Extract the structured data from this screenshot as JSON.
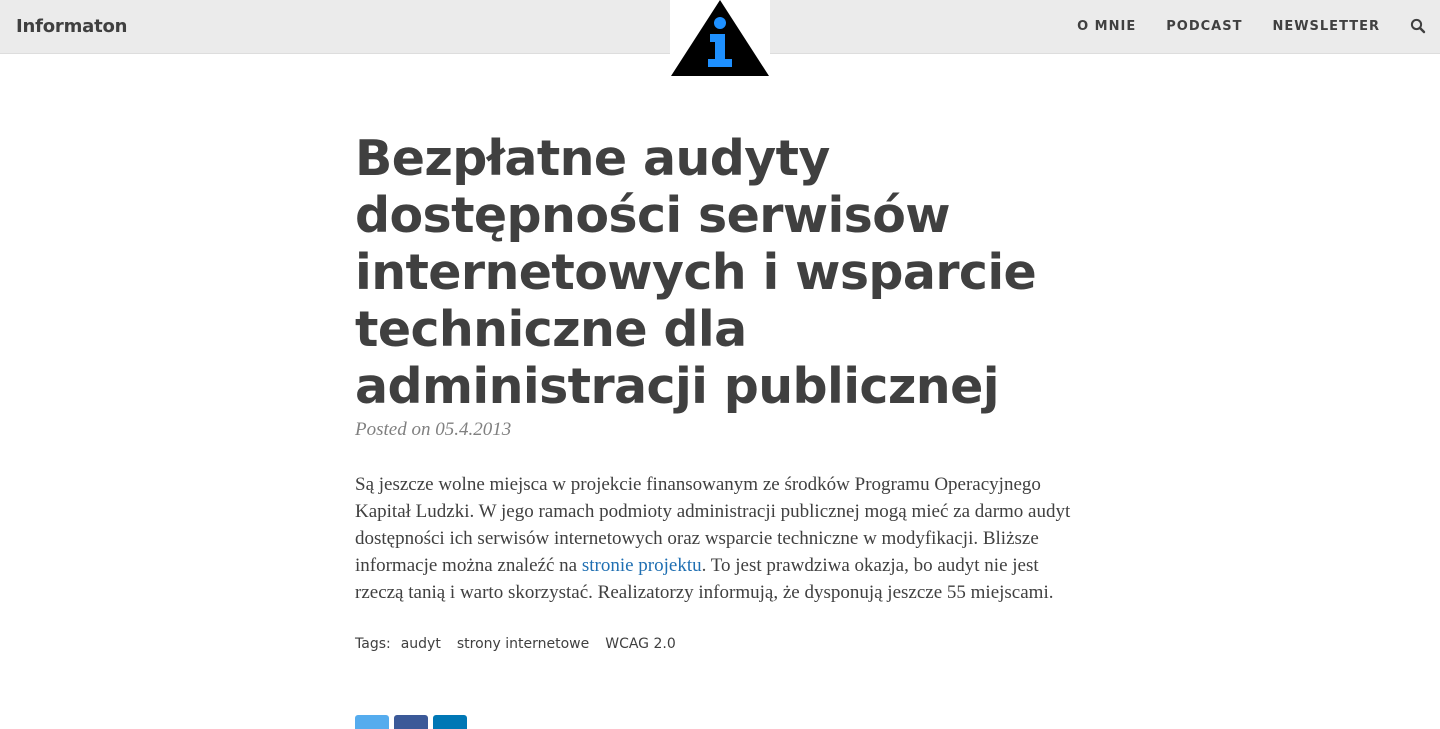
{
  "navbar": {
    "brand": "Informaton",
    "links": [
      {
        "label": "O MNIE"
      },
      {
        "label": "PODCAST"
      },
      {
        "label": "NEWSLETTER"
      }
    ],
    "search_icon": "search-icon",
    "logo_icon": "info-triangle-logo"
  },
  "post": {
    "title": "Bezpłatne audyty dostępności serwisów internetowych i wsparcie techniczne dla administracji publicznej",
    "meta": "Posted on 05.4.2013",
    "body_before_link": "Są jeszcze wolne miejsca w projekcie finansowanym ze środków Programu Operacyjnego Kapitał Ludzki. W jego ramach podmioty administracji publicznej mogą mieć za darmo audyt dostępności ich serwisów internetowych oraz wsparcie techniczne w modyfikacji. Bliższe informacje można znaleźć na ",
    "link_text": "stronie projektu",
    "body_after_link": ". To jest prawdziwa okazja, bo audyt nie jest rzeczą tanią i warto skorzystać. Realizatorzy informują, że dysponują jeszcze 55 miejscami."
  },
  "tags": {
    "label": "Tags:",
    "items": [
      "audyt",
      "strony internetowe",
      "WCAG 2.0"
    ]
  },
  "share": {
    "buttons": [
      {
        "icon": "twitter-icon",
        "color": "#55acee"
      },
      {
        "icon": "facebook-icon",
        "color": "#3b5998"
      },
      {
        "icon": "linkedin-icon",
        "color": "#0077b5"
      }
    ]
  },
  "colors": {
    "navbar_bg": "#ebebeb",
    "text": "#404040",
    "meta": "#808080",
    "link": "#1f6fb2",
    "logo_blue": "#1e90ff"
  }
}
